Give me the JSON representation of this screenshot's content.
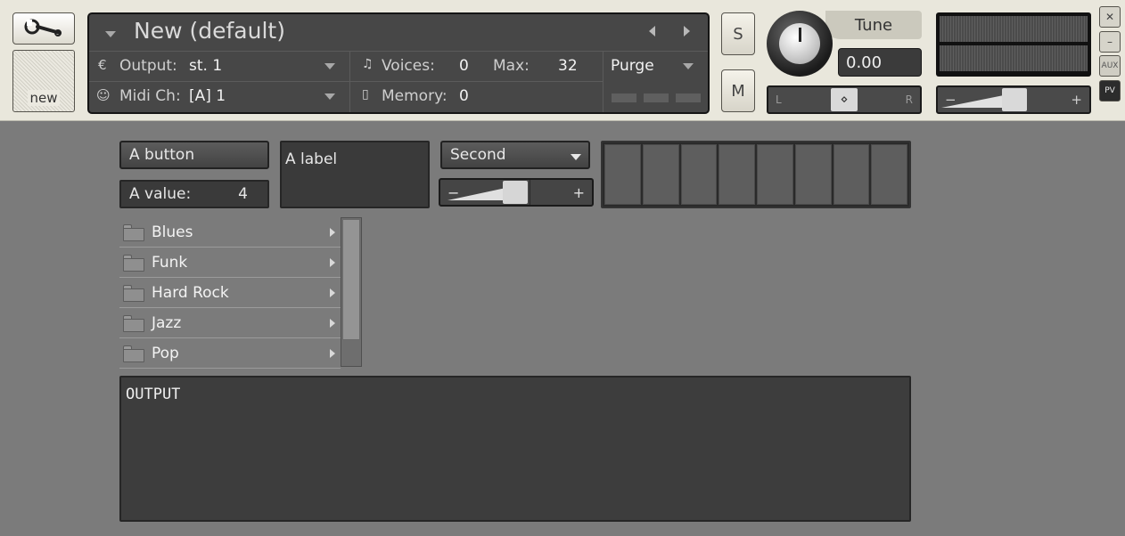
{
  "header": {
    "new_label": "new",
    "instrument": {
      "title": "New (default)",
      "output_label": "Output:",
      "output_value": "st. 1",
      "voices_label": "Voices:",
      "voices_value": "0",
      "max_label": "Max:",
      "max_value": "32",
      "purge_label": "Purge",
      "midi_label": "Midi Ch:",
      "midi_value": "[A]  1",
      "memory_label": "Memory:",
      "memory_value": "0"
    },
    "solo_label": "S",
    "mute_label": "M",
    "tune": {
      "label": "Tune",
      "value": "0.00"
    },
    "pan": {
      "left": "L",
      "right": "R"
    },
    "volume": {
      "minus": "−",
      "plus": "+"
    },
    "window_buttons": {
      "close": "✕",
      "minimize": "–",
      "aux": "AUX",
      "pv": "PV"
    }
  },
  "controls": {
    "button_label": "A button",
    "value_label": "A value:",
    "value": "4",
    "text_label": "A label",
    "menu_selected": "Second",
    "slider": {
      "minus": "−",
      "plus": "+",
      "level": 0.5
    },
    "step_grid_cells": 8
  },
  "file_browser": {
    "items": [
      {
        "label": "Blues"
      },
      {
        "label": "Funk"
      },
      {
        "label": "Hard Rock"
      },
      {
        "label": "Jazz"
      },
      {
        "label": "Pop"
      }
    ]
  },
  "output": {
    "text": "OUTPUT"
  },
  "colors": {
    "background": "#7b7b7b",
    "header_bg": "#e9e7dc",
    "panel_bg": "#474747",
    "control_dark": "#3a3a3a"
  },
  "icons": [
    "wrench-icon",
    "folder-icon",
    "chevron-down-icon",
    "arrow-left-icon",
    "arrow-right-icon",
    "output-icon",
    "midi-icon",
    "voices-icon",
    "memory-icon"
  ]
}
